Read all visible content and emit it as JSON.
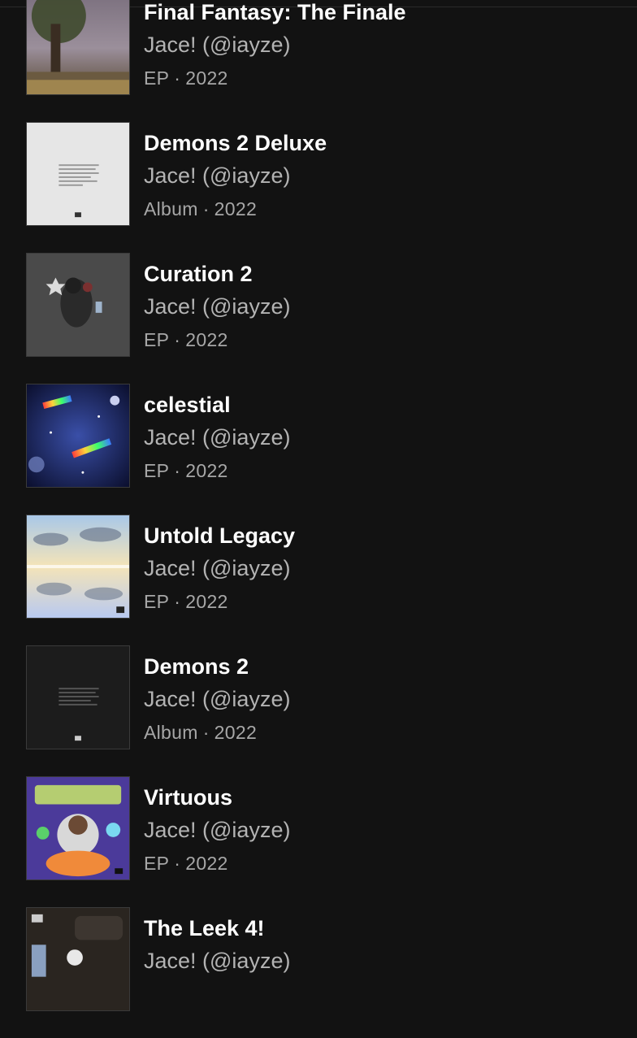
{
  "separator": "·",
  "releases": [
    {
      "title": "Final Fantasy: The Finale",
      "artist": "Jace! (@iayze)",
      "type": "EP",
      "year": "2022"
    },
    {
      "title": "Demons 2 Deluxe",
      "artist": "Jace! (@iayze)",
      "type": "Album",
      "year": "2022"
    },
    {
      "title": "Curation 2",
      "artist": "Jace! (@iayze)",
      "type": "EP",
      "year": "2022"
    },
    {
      "title": "celestial",
      "artist": "Jace! (@iayze)",
      "type": "EP",
      "year": "2022"
    },
    {
      "title": "Untold Legacy",
      "artist": "Jace! (@iayze)",
      "type": "EP",
      "year": "2022"
    },
    {
      "title": "Demons 2",
      "artist": "Jace! (@iayze)",
      "type": "Album",
      "year": "2022"
    },
    {
      "title": "Virtuous",
      "artist": "Jace! (@iayze)",
      "type": "EP",
      "year": "2022"
    },
    {
      "title": "The Leek 4!",
      "artist": "Jace! (@iayze)",
      "type": "",
      "year": ""
    }
  ]
}
